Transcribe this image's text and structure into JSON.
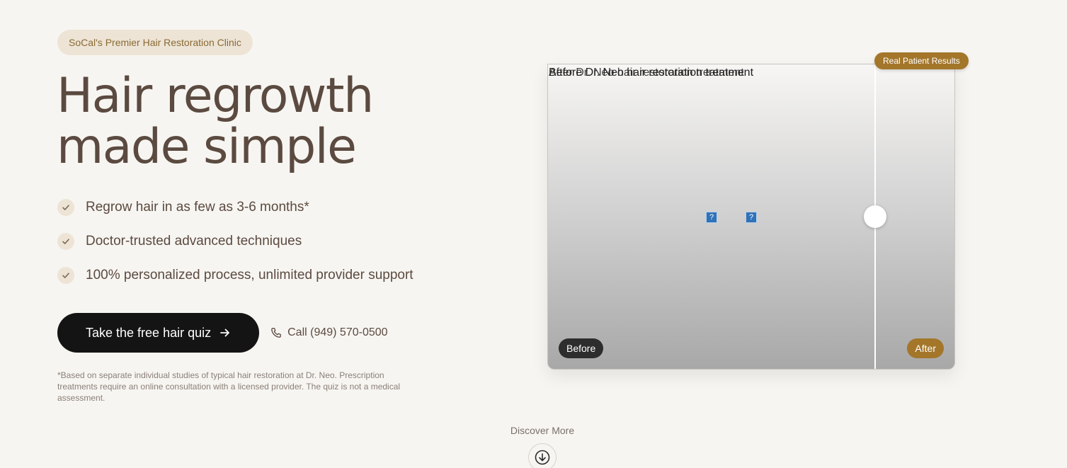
{
  "hero": {
    "badge": "SoCal's Premier Hair Restoration Clinic",
    "headline_line1": "Hair regrowth",
    "headline_line2": "made simple",
    "features": [
      "Regrow hair in as few as 3-6 months*",
      "Doctor-trusted advanced techniques",
      "100% personalized process, unlimited provider support"
    ],
    "cta_label": "Take the free hair quiz",
    "phone_label": "Call (949) 570-0500",
    "disclaimer": "*Based on separate individual studies of typical hair restoration at Dr. Neo. Prescription treatments require an online consultation with a licensed provider. The quiz is not a medical assessment."
  },
  "comparison": {
    "results_badge": "Real Patient Results",
    "before_alt": "Before Dr. Neo hair restoration treatment",
    "after_alt": "After Dr. Neo hair restoration treatment",
    "before_label": "Before",
    "after_label": "After",
    "slider_position_pct": 80.5
  },
  "discover": {
    "label": "Discover More"
  },
  "colors": {
    "background": "#f7f5f1",
    "text": "#5b4a40",
    "accent_gold": "#a3762a",
    "badge_bg": "#ede4d6",
    "cta_bg": "#141414"
  },
  "icons": {
    "feature": "check-icon",
    "cta": "arrow-right-icon",
    "phone": "phone-icon",
    "discover": "arrow-down-circle-icon"
  }
}
